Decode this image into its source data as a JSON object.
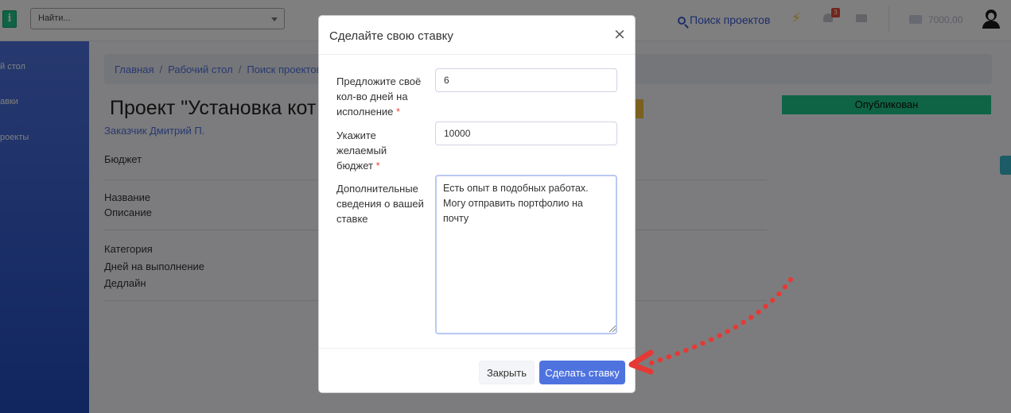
{
  "header": {
    "search_placeholder": "Найти...",
    "find_projects": "Поиск проектов",
    "notifications_count": "3",
    "balance": "7000,00"
  },
  "sidebar": {
    "items": [
      {
        "label": "й стол"
      },
      {
        "label": "авки"
      },
      {
        "label": "роекты"
      }
    ]
  },
  "breadcrumb": [
    "Главная",
    "Рабочий стол",
    "Поиск проектов"
  ],
  "project": {
    "title": "Проект \"Установка кот",
    "customer": "Заказчик Дмитрий П.",
    "status": "Опубликован",
    "labels": {
      "budget": "Бюджет",
      "name": "Название",
      "description": "Описание",
      "category": "Категория",
      "days": "Дней на выполнение",
      "deadline": "Дедлайн"
    }
  },
  "modal": {
    "title": "Сделайте свою ставку",
    "close_symbol": "×",
    "fields": {
      "days_label": "Предложите своё кол-во дней на исполнение",
      "days_value": "6",
      "budget_label": "Укажите желаемый бюджет",
      "budget_value": "10000",
      "details_label": "Дополнительные сведения о вашей ставке",
      "details_value": "Есть опыт в подобных работах. Могу отправить портфолио на почту"
    },
    "required_mark": "*",
    "buttons": {
      "close": "Закрыть",
      "submit": "Сделать ставку"
    }
  },
  "colors": {
    "primary": "#4e73df",
    "success": "#1cc88a",
    "annotation_arrow": "#e53935"
  }
}
